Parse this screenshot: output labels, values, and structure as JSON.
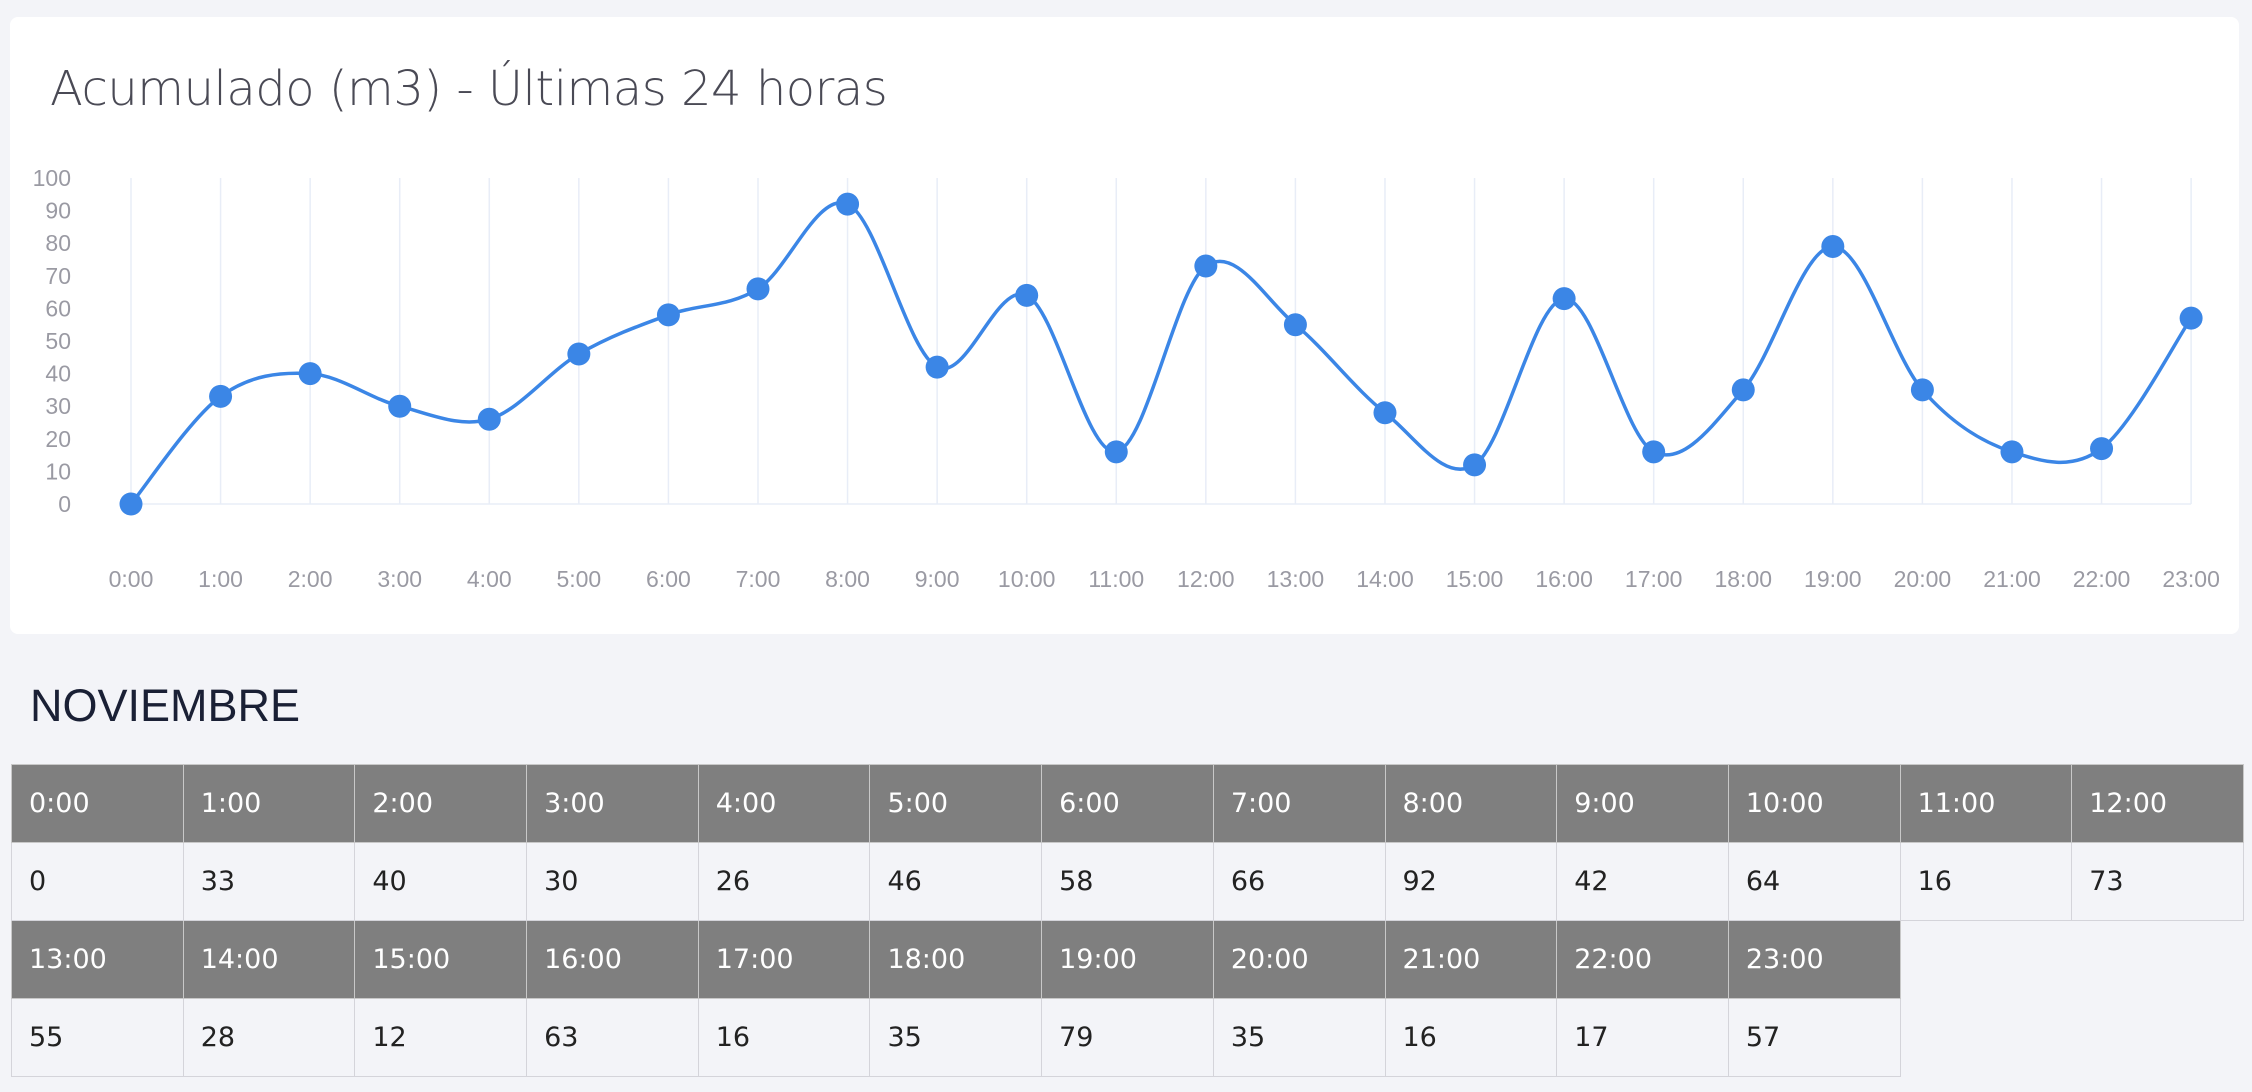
{
  "card": {
    "title": "Acumulado (m3) - Últimas 24 horas"
  },
  "section": {
    "title": "NOVIEMBRE"
  },
  "colors": {
    "line": "#3b86e6",
    "point": "#3b86e6",
    "grid": "#e8edf7",
    "header_bg": "#7f7f7f"
  },
  "chart_data": {
    "type": "line",
    "smooth": true,
    "title": "Acumulado (m3) - Últimas 24 horas",
    "categories": [
      "0:00",
      "1:00",
      "2:00",
      "3:00",
      "4:00",
      "5:00",
      "6:00",
      "7:00",
      "8:00",
      "9:00",
      "10:00",
      "11:00",
      "12:00",
      "13:00",
      "14:00",
      "15:00",
      "16:00",
      "17:00",
      "18:00",
      "19:00",
      "20:00",
      "21:00",
      "22:00",
      "23:00"
    ],
    "series": [
      {
        "values": [
          0,
          33,
          40,
          30,
          26,
          46,
          58,
          66,
          92,
          42,
          64,
          16,
          73,
          55,
          28,
          12,
          63,
          16,
          35,
          79,
          35,
          16,
          17,
          57
        ]
      }
    ],
    "ylim": [
      0,
      100
    ],
    "yticks": [
      0,
      10,
      20,
      30,
      40,
      50,
      60,
      70,
      80,
      90,
      100
    ],
    "grid": {
      "vertical": true,
      "horizontal": false
    },
    "legend": "none"
  },
  "table": {
    "rows": [
      {
        "hours": [
          "0:00",
          "1:00",
          "2:00",
          "3:00",
          "4:00",
          "5:00",
          "6:00",
          "7:00",
          "8:00",
          "9:00",
          "10:00",
          "11:00",
          "12:00"
        ],
        "values": [
          "0",
          "33",
          "40",
          "30",
          "26",
          "46",
          "58",
          "66",
          "92",
          "42",
          "64",
          "16",
          "73"
        ]
      },
      {
        "hours": [
          "13:00",
          "14:00",
          "15:00",
          "16:00",
          "17:00",
          "18:00",
          "19:00",
          "20:00",
          "21:00",
          "22:00",
          "23:00"
        ],
        "values": [
          "55",
          "28",
          "12",
          "63",
          "16",
          "35",
          "79",
          "35",
          "16",
          "17",
          "57"
        ]
      }
    ]
  }
}
